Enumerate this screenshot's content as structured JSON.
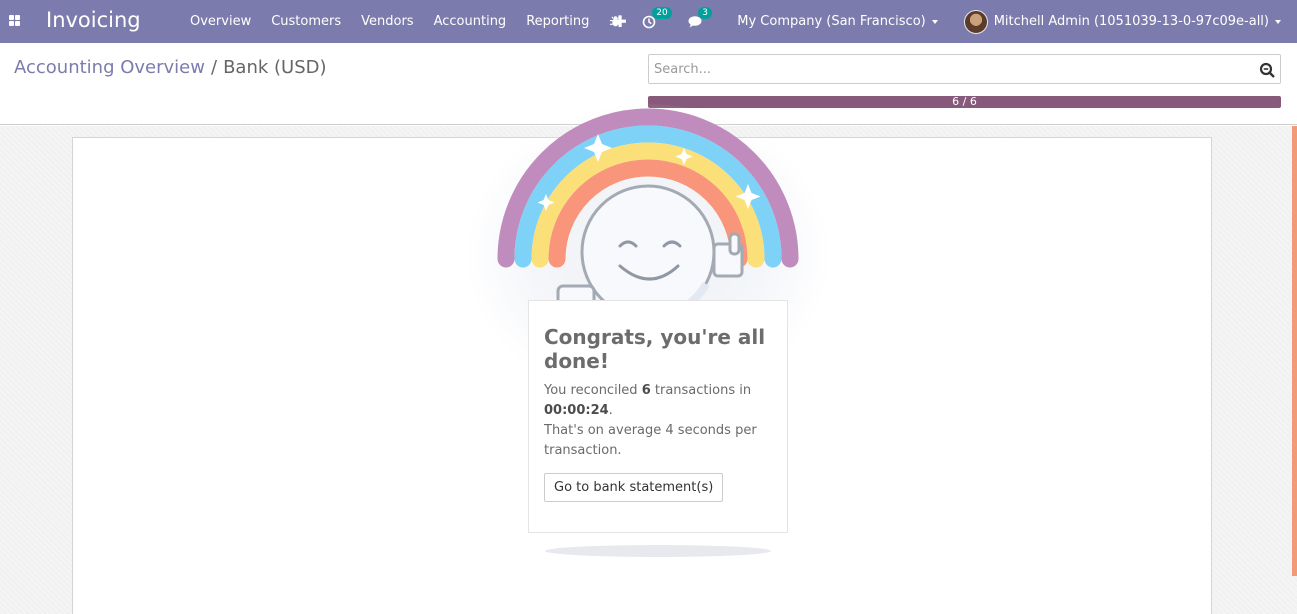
{
  "navbar": {
    "app_title": "Invoicing",
    "menu": [
      "Overview",
      "Customers",
      "Vendors",
      "Accounting",
      "Reporting"
    ],
    "activity_count": "20",
    "message_count": "3",
    "company": "My Company (San Francisco)",
    "user": "Mitchell Admin (1051039-13-0-97c09e-all)"
  },
  "breadcrumb": {
    "parent": "Accounting Overview",
    "separator": "/",
    "current": "Bank (USD)"
  },
  "search": {
    "placeholder": "Search..."
  },
  "progress": {
    "label": "6 / 6",
    "done": 6,
    "total": 6
  },
  "congrats": {
    "title": "Congrats, you're all done!",
    "text_prefix": "You reconciled ",
    "count": "6",
    "text_mid": " transactions in ",
    "duration": "00:00:24",
    "text_end": ".",
    "average": "That's on average 4 seconds per transaction.",
    "button": "Go to bank statement(s)"
  },
  "colors": {
    "navbar": "#7c7bad",
    "progress": "#875a7b",
    "badge": "#00a09d"
  }
}
